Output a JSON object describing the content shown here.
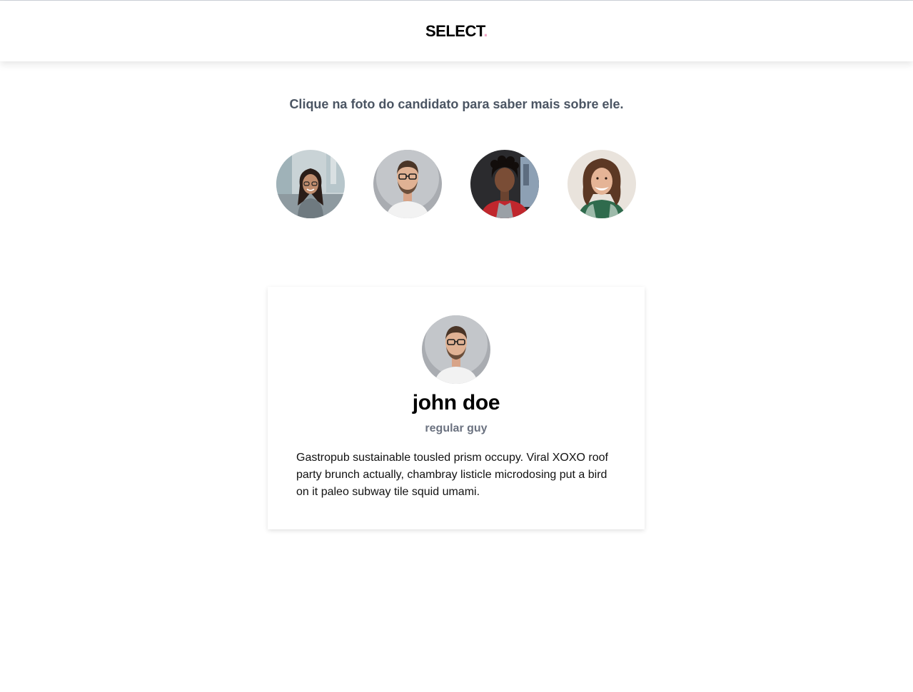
{
  "header": {
    "logo_text": "SELECT",
    "logo_dot": ".",
    "accent_color": "#f0a8c8"
  },
  "instructions": "Clique na foto do candidato para saber mais sobre ele.",
  "candidates": [
    {
      "photo_icon": "woman-glasses-street-photo"
    },
    {
      "photo_icon": "man-glasses-beard-photo"
    },
    {
      "photo_icon": "young-man-curly-hair-photo"
    },
    {
      "photo_icon": "woman-curly-hair-smiling-photo"
    }
  ],
  "selected": {
    "photo_icon": "man-glasses-beard-photo",
    "name": "john doe",
    "role": "regular guy",
    "bio": "Gastropub sustainable tousled prism occupy. Viral XOXO roof party brunch actually, chambray listicle microdosing put a bird on it paleo subway tile squid umami."
  }
}
